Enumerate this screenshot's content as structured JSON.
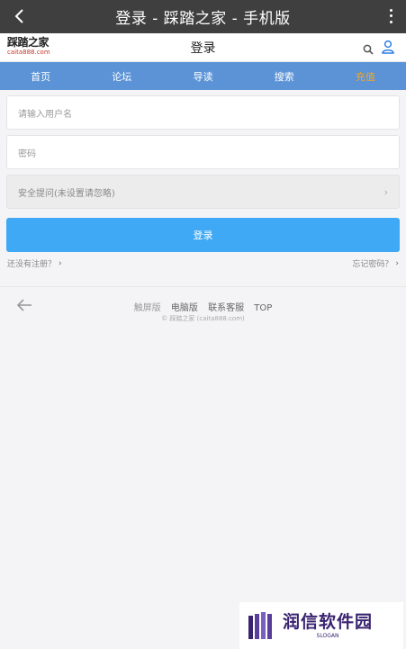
{
  "appbar": {
    "title": "登录 - 踩踏之家 - 手机版"
  },
  "site": {
    "logo_cn": "踩踏之家",
    "logo_en": "caita888.com",
    "page_title": "登录"
  },
  "nav": [
    {
      "label": "首页"
    },
    {
      "label": "论坛"
    },
    {
      "label": "导读"
    },
    {
      "label": "搜索"
    },
    {
      "label": "充值"
    }
  ],
  "form": {
    "username_placeholder": "请输入用户名",
    "password_placeholder": "密码",
    "question_label": "安全提问(未设置请忽略)",
    "login_label": "登录"
  },
  "links": {
    "register": "还没有注册？",
    "forgot": "忘记密码？"
  },
  "footer": {
    "links": [
      "触屏版",
      "电脑版",
      "联系客服",
      "TOP"
    ],
    "copyright": "© 踩踏之家 (caita888.com)"
  },
  "watermark": {
    "name": "润信软件园",
    "slogan": "SLOGAN"
  },
  "colors": {
    "appbar": "#3f3f3f",
    "nav": "#5b93d6",
    "nav_hot": "#f5a623",
    "button": "#3fa9f5",
    "user_icon": "#2f7fe0"
  }
}
